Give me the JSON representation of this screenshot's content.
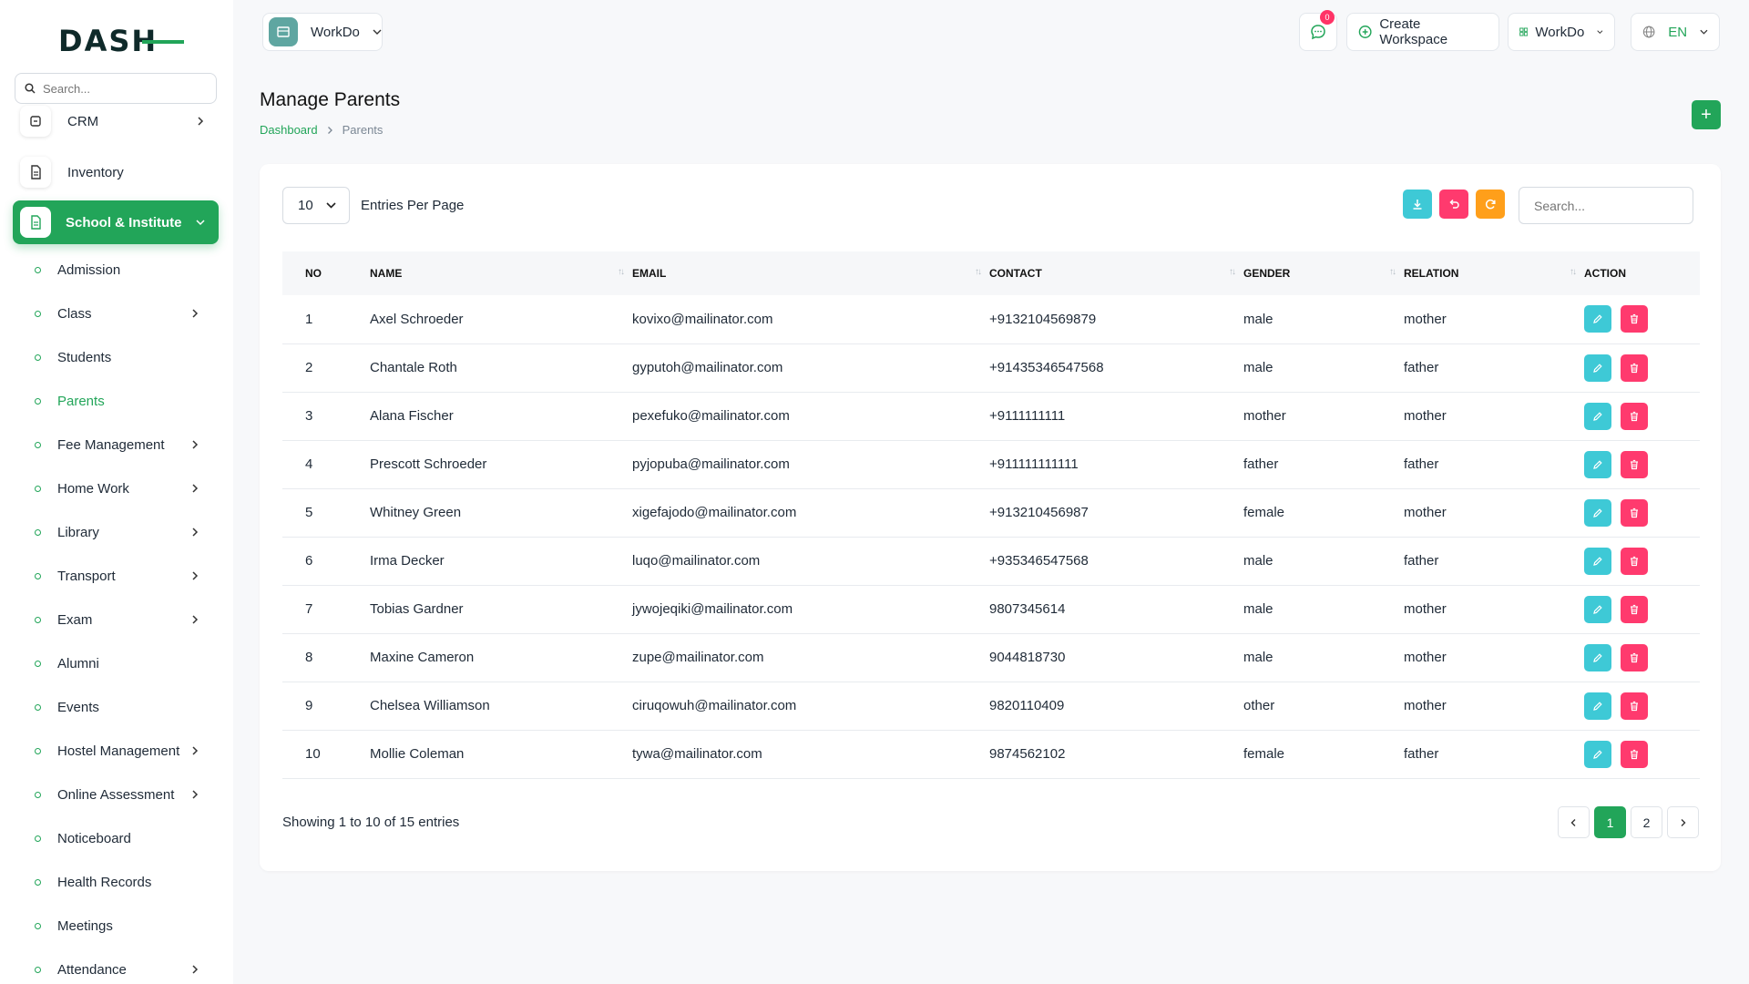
{
  "brand": {
    "logo_text_a": "DASH",
    "colors": {
      "primary": "#22a559",
      "info": "#3ec9d6",
      "danger": "#ff3a6e",
      "warning": "#ff9f1a"
    }
  },
  "sidebar": {
    "search_placeholder": "Search...",
    "top_items": [
      {
        "label": "CRM",
        "icon": "crm-icon",
        "has_children": true
      },
      {
        "label": "Inventory",
        "icon": "document-icon",
        "has_children": false
      }
    ],
    "active_section": {
      "label": "School & Institute",
      "icon": "school-icon"
    },
    "sub_items": [
      {
        "label": "Admission",
        "has_children": false
      },
      {
        "label": "Class",
        "has_children": true
      },
      {
        "label": "Students",
        "has_children": false
      },
      {
        "label": "Parents",
        "has_children": false,
        "active": true
      },
      {
        "label": "Fee Management",
        "has_children": true
      },
      {
        "label": "Home Work",
        "has_children": true
      },
      {
        "label": "Library",
        "has_children": true
      },
      {
        "label": "Transport",
        "has_children": true
      },
      {
        "label": "Exam",
        "has_children": true
      },
      {
        "label": "Alumni",
        "has_children": false
      },
      {
        "label": "Events",
        "has_children": false
      },
      {
        "label": "Hostel Management",
        "has_children": true
      },
      {
        "label": "Online Assessment",
        "has_children": true
      },
      {
        "label": "Noticeboard",
        "has_children": false
      },
      {
        "label": "Health Records",
        "has_children": false
      },
      {
        "label": "Meetings",
        "has_children": false
      },
      {
        "label": "Attendance",
        "has_children": true
      }
    ]
  },
  "header": {
    "workspace_label": "WorkDo",
    "messages_count": "0",
    "create_workspace": "Create Workspace",
    "workspace_switch": "WorkDo",
    "language": "EN"
  },
  "page": {
    "title": "Manage Parents",
    "breadcrumb": [
      "Dashboard",
      "Parents"
    ],
    "add_label": "+"
  },
  "table": {
    "entries_value": "10",
    "entries_label": "Entries Per Page",
    "search_placeholder": "Search...",
    "columns": [
      "NO",
      "NAME",
      "EMAIL",
      "CONTACT",
      "GENDER",
      "RELATION",
      "ACTION"
    ],
    "rows": [
      {
        "no": "1",
        "name": "Axel Schroeder",
        "email": "kovixo@mailinator.com",
        "contact": "+9132104569879",
        "gender": "male",
        "relation": "mother"
      },
      {
        "no": "2",
        "name": "Chantale Roth",
        "email": "gyputoh@mailinator.com",
        "contact": "+91435346547568",
        "gender": "male",
        "relation": "father"
      },
      {
        "no": "3",
        "name": "Alana Fischer",
        "email": "pexefuko@mailinator.com",
        "contact": "+9111111111",
        "gender": "mother",
        "relation": "mother"
      },
      {
        "no": "4",
        "name": "Prescott Schroeder",
        "email": "pyjopuba@mailinator.com",
        "contact": "+911111111111",
        "gender": "father",
        "relation": "father"
      },
      {
        "no": "5",
        "name": "Whitney Green",
        "email": "xigefajodo@mailinator.com",
        "contact": "+913210456987",
        "gender": "female",
        "relation": "mother"
      },
      {
        "no": "6",
        "name": "Irma Decker",
        "email": "luqo@mailinator.com",
        "contact": "+935346547568",
        "gender": "male",
        "relation": "father"
      },
      {
        "no": "7",
        "name": "Tobias Gardner",
        "email": "jywojeqiki@mailinator.com",
        "contact": "9807345614",
        "gender": "male",
        "relation": "mother"
      },
      {
        "no": "8",
        "name": "Maxine Cameron",
        "email": "zupe@mailinator.com",
        "contact": "9044818730",
        "gender": "male",
        "relation": "mother"
      },
      {
        "no": "9",
        "name": "Chelsea Williamson",
        "email": "ciruqowuh@mailinator.com",
        "contact": "9820110409",
        "gender": "other",
        "relation": "mother"
      },
      {
        "no": "10",
        "name": "Mollie Coleman",
        "email": "tywa@mailinator.com",
        "contact": "9874562102",
        "gender": "female",
        "relation": "father"
      }
    ],
    "showing_text": "Showing 1 to 10 of 15 entries",
    "pages": [
      "1",
      "2"
    ],
    "current_page": "1"
  }
}
